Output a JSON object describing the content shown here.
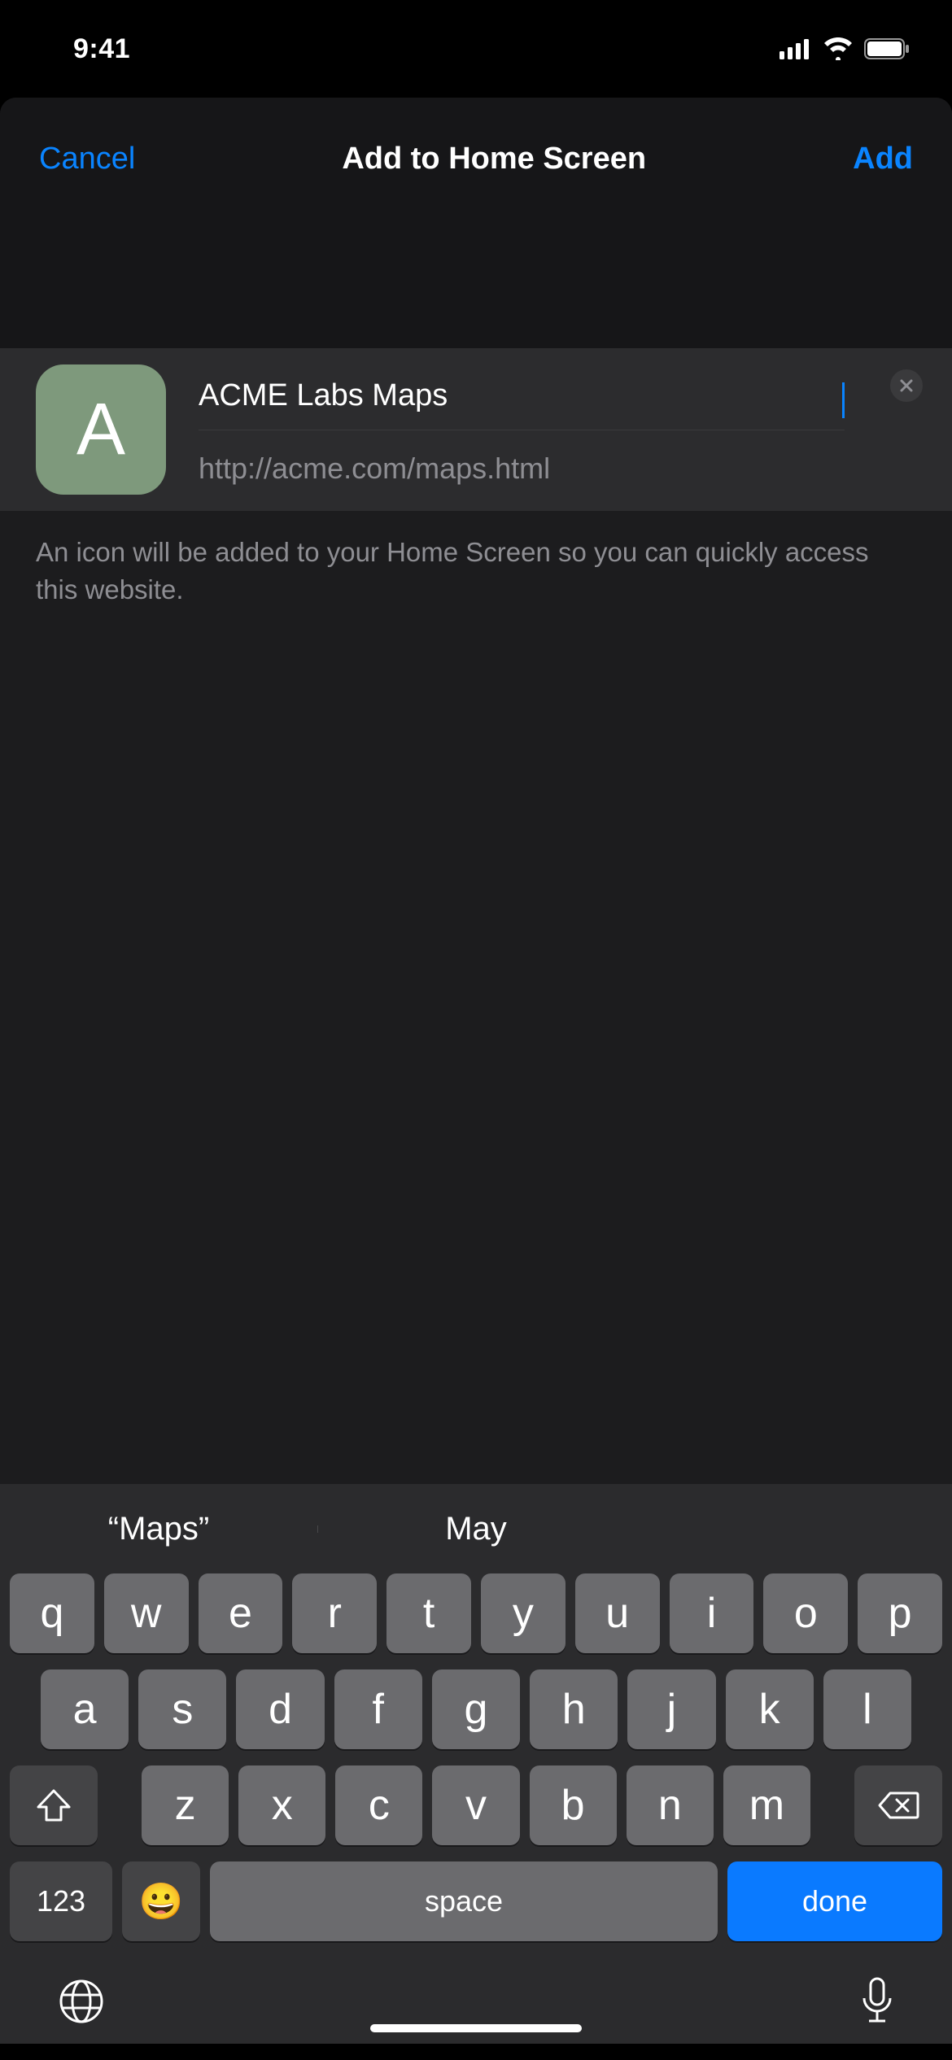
{
  "status": {
    "time": "9:41"
  },
  "nav": {
    "cancel": "Cancel",
    "title": "Add to Home Screen",
    "add": "Add"
  },
  "form": {
    "icon_letter": "A",
    "title_value": "ACME Labs Maps",
    "url": "http://acme.com/maps.html"
  },
  "hint": "An icon will be added to your Home Screen so you can quickly access this website.",
  "keyboard": {
    "suggestions": [
      "“Maps”",
      "May",
      ""
    ],
    "row1": [
      "q",
      "w",
      "e",
      "r",
      "t",
      "y",
      "u",
      "i",
      "o",
      "p"
    ],
    "row2": [
      "a",
      "s",
      "d",
      "f",
      "g",
      "h",
      "j",
      "k",
      "l"
    ],
    "row3": [
      "z",
      "x",
      "c",
      "v",
      "b",
      "n",
      "m"
    ],
    "num_label": "123",
    "space_label": "space",
    "done_label": "done"
  }
}
